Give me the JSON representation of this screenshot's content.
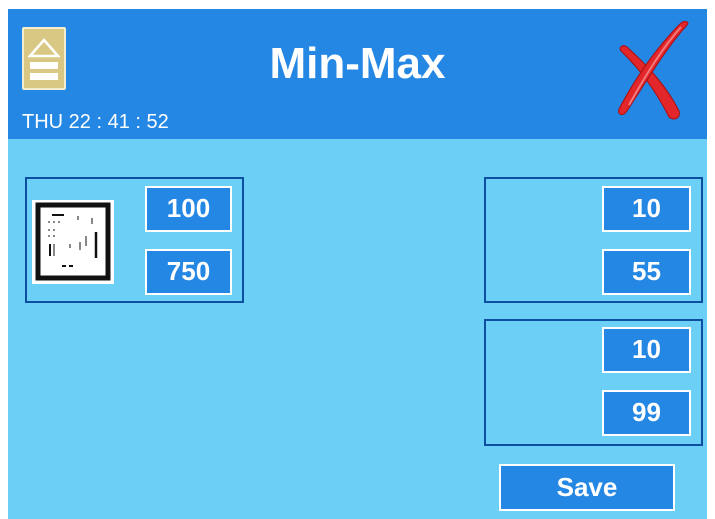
{
  "header": {
    "title": "Min-Max",
    "clock": "THU 22 : 41 : 52",
    "home_icon": "eject-home-icon",
    "close_icon": "red-x-close-icon"
  },
  "groups": [
    {
      "min": "100",
      "max": "750",
      "icon": "sensor-board-icon"
    },
    {
      "min": "10",
      "max": "55"
    },
    {
      "min": "10",
      "max": "99"
    }
  ],
  "actions": {
    "save_label": "Save"
  },
  "colors": {
    "background": "#6ccff6",
    "header": "#2587e4",
    "value_box": "#2587e4",
    "group_border": "#0c4fa3",
    "home_button": "#d9c883",
    "close_red": "#e3262a"
  }
}
